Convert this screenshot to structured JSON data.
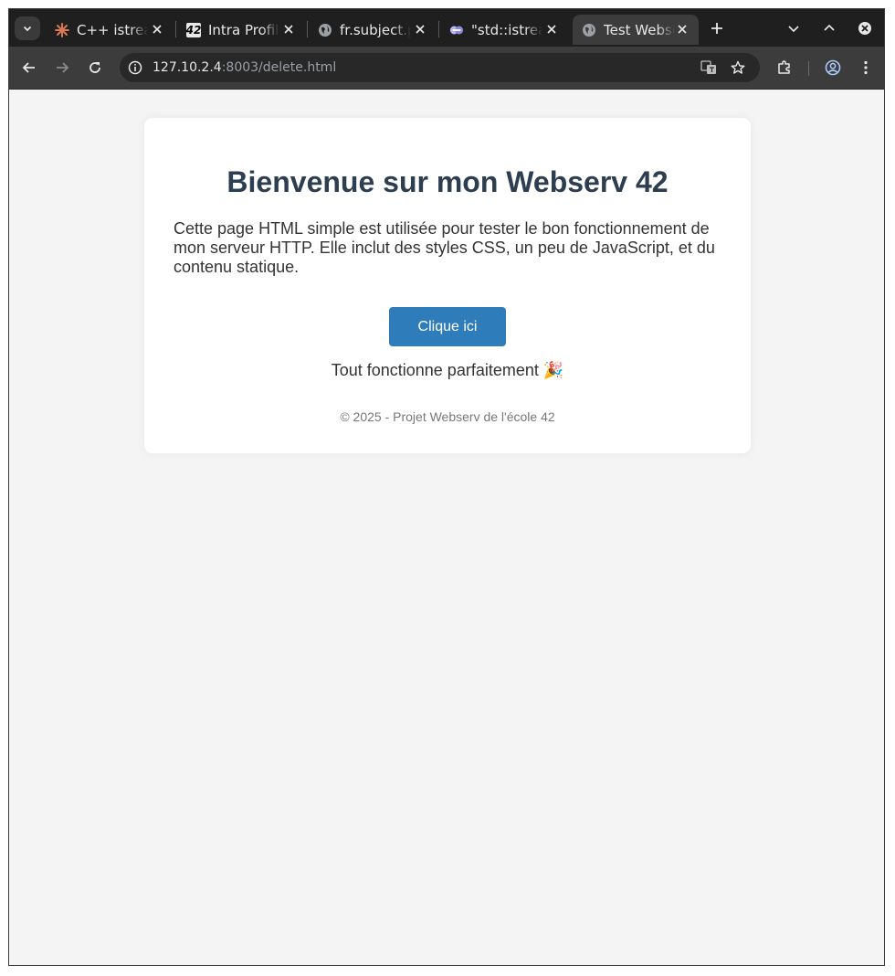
{
  "browser": {
    "tabs": [
      {
        "title": "C++ istream",
        "icon": "claude-icon",
        "active": false
      },
      {
        "title": "Intra Profile",
        "icon": "42-logo-icon",
        "active": false
      },
      {
        "title": "fr.subject.pdf",
        "icon": "globe-icon",
        "active": false
      },
      {
        "title": "\"std::istream",
        "icon": "cplusplus-icon",
        "active": false
      },
      {
        "title": "Test Webserv",
        "icon": "globe-icon",
        "active": true
      }
    ],
    "favicon_42_text": "42",
    "url_host": "127.10.2.4",
    "url_rest": ":8003/delete.html"
  },
  "page": {
    "heading": "Bienvenue sur mon Webserv 42",
    "intro": "Cette page HTML simple est utilisée pour tester le bon fonctionnement de mon serveur HTTP. Elle inclut des styles CSS, un peu de JavaScript, et du contenu statique.",
    "button_label": "Clique ici",
    "status_message": "Tout fonctionne parfaitement 🎉",
    "footer": "© 2025 - Projet Webserv de l'école 42"
  },
  "colors": {
    "heading": "#2c3e50",
    "button": "#2f7cba",
    "page_background": "#f4f4f4"
  }
}
